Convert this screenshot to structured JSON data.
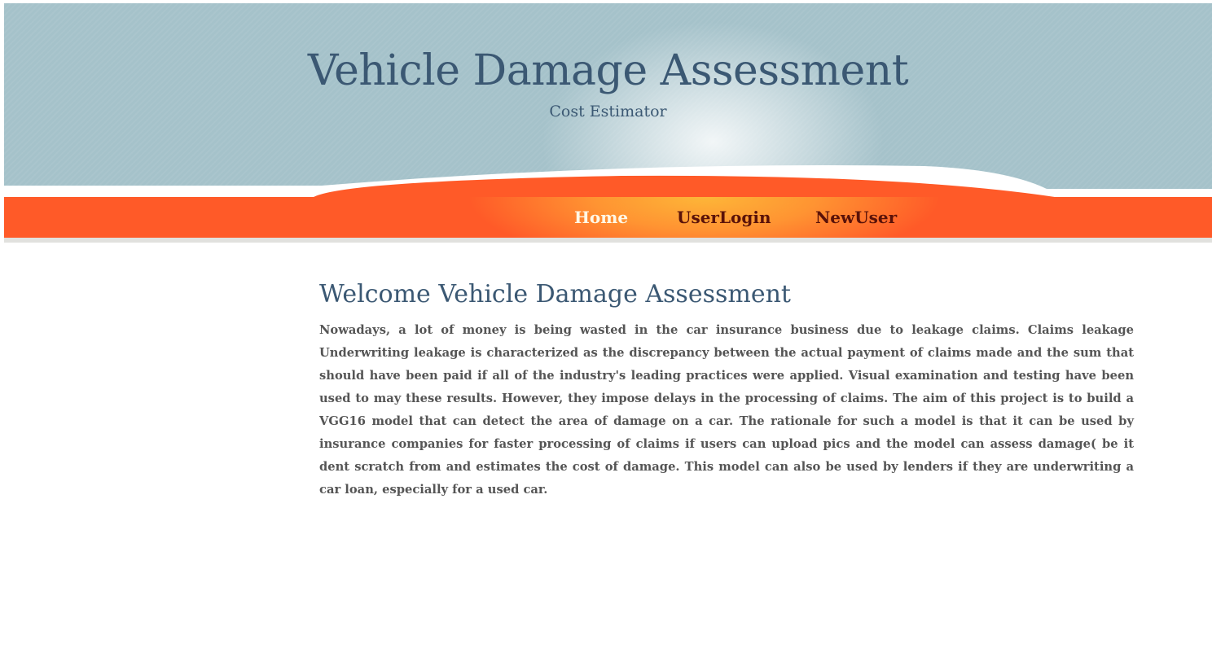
{
  "header": {
    "title": "Vehicle Damage Assessment",
    "subtitle": "Cost Estimator"
  },
  "nav": {
    "home": "Home",
    "user_login": "UserLogin",
    "new_user": "NewUser",
    "active": "Home"
  },
  "main": {
    "heading": "Welcome Vehicle Damage Assessment",
    "paragraph": "Nowadays, a lot of money is being wasted in the car insurance business due to leakage claims. Claims leakage Underwriting leakage is characterized as the discrepancy between the actual payment of claims made and the sum that should have been paid if all of the industry's leading practices were applied. Visual examination and testing have been used to may these results. However, they impose delays in the processing of claims. The aim of this project is to build a VGG16 model that can detect the area of damage on a car. The rationale for such a model is that it can be used by insurance companies for faster processing of claims if users can upload pics and the model can assess damage( be it dent scratch from and estimates the cost of damage. This model can also be used by lenders if they are underwriting a car loan, especially for a used car."
  },
  "colors": {
    "header_bg": "#a5c2ca",
    "title_text": "#3b5873",
    "nav_bg": "#ff5a28",
    "nav_highlight": "#fdb638",
    "nav_link": "#5a1209",
    "nav_active_link": "#fff8e6",
    "body_text": "#555555"
  }
}
